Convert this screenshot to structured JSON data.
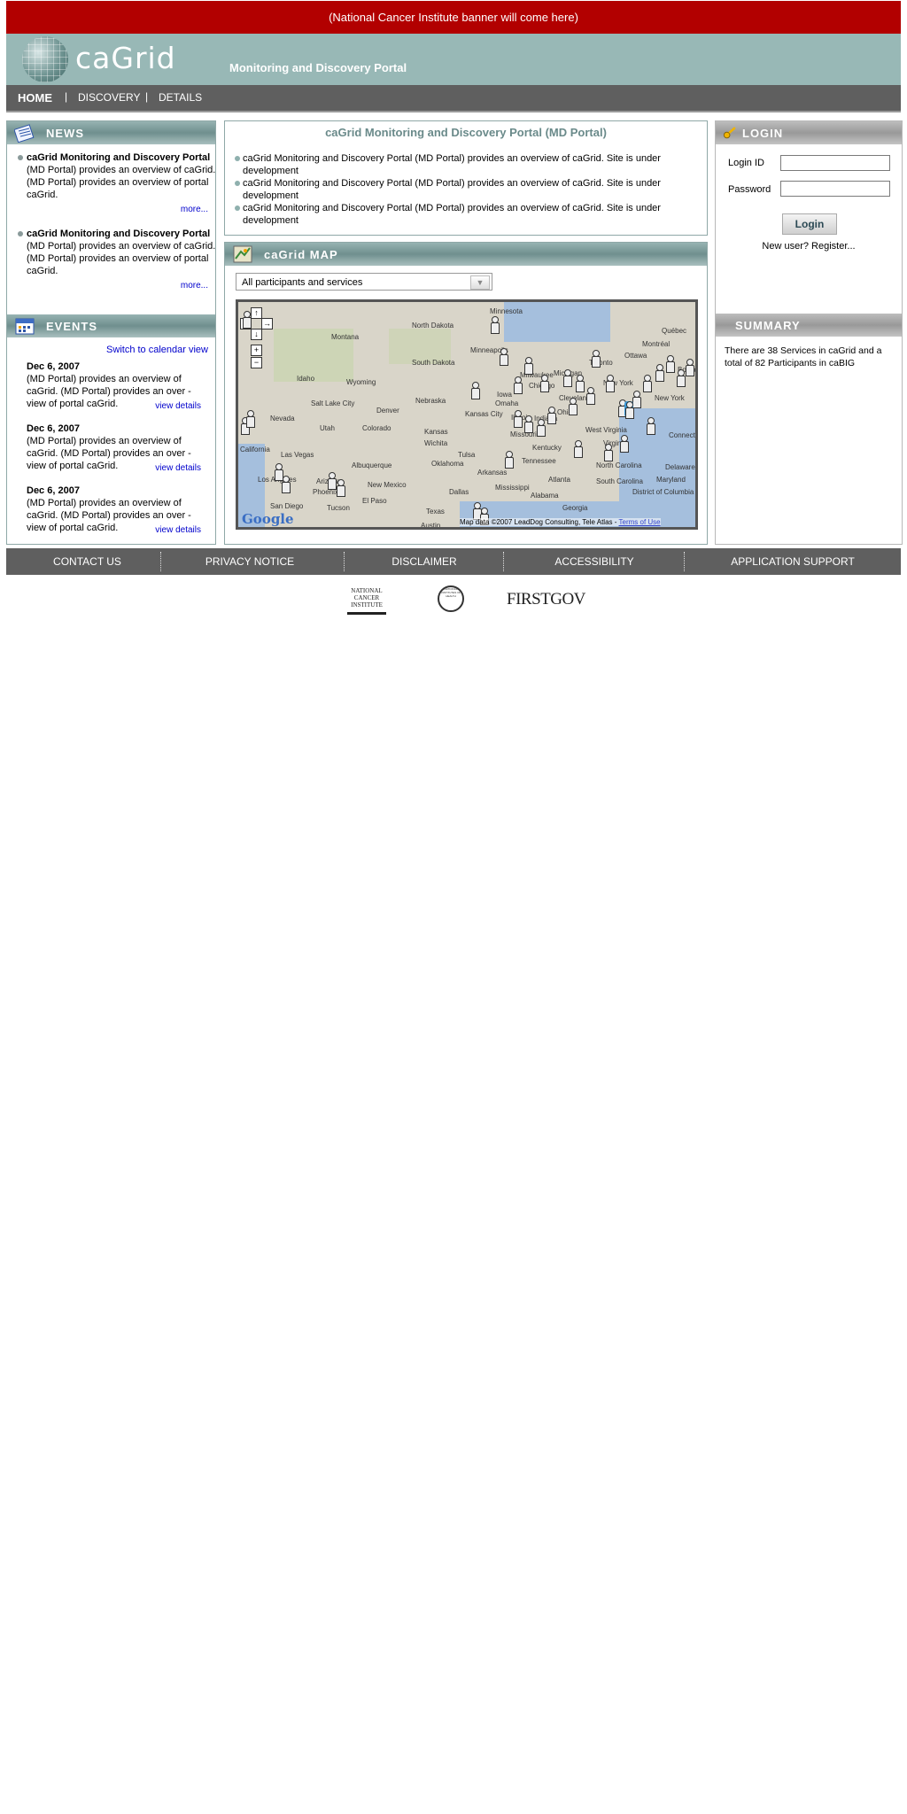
{
  "banner": {
    "text": "(National Cancer Institute banner will come here)"
  },
  "header": {
    "logo_text": "caGrid",
    "portal_title": "Monitoring and Discovery Portal"
  },
  "nav": {
    "items": [
      "HOME",
      "DISCOVERY",
      "DETAILS"
    ],
    "separator": "|"
  },
  "news": {
    "heading": "NEWS",
    "items": [
      {
        "title": "caGrid Monitoring and Discovery Portal",
        "body": "(MD Portal) provides an overview of caGrid. (MD Portal) provides an overview of portal caGrid.",
        "more": "more..."
      },
      {
        "title": "caGrid Monitoring and Discovery Portal",
        "body": "(MD Portal) provides an overview of caGrid. (MD Portal) provides an overview of portal caGrid.",
        "more": "more..."
      }
    ]
  },
  "events": {
    "heading": "EVENTS",
    "calendar_link": "Switch to calendar view",
    "items": [
      {
        "date": "Dec 6, 2007",
        "body": "(MD Portal) provides an overview of caGrid. (MD Portal) provides an over - view of portal caGrid.",
        "link": "view details"
      },
      {
        "date": "Dec 6, 2007",
        "body": "(MD Portal) provides an overview of caGrid. (MD Portal) provides an over - view of portal caGrid.",
        "link": "view details"
      },
      {
        "date": "Dec 6, 2007",
        "body": "(MD Portal) provides an overview of caGrid. (MD Portal) provides an over - view of portal caGrid.",
        "link": "view details"
      }
    ]
  },
  "intro": {
    "title": "caGrid Monitoring and Discovery Portal (MD Portal)",
    "lines": [
      "caGrid Monitoring and Discovery Portal (MD Portal) provides an overview of caGrid.  Site is under development",
      "caGrid Monitoring and Discovery Portal (MD Portal) provides an overview of caGrid.  Site is under development",
      "caGrid Monitoring and Discovery Portal (MD Portal) provides an overview of caGrid.  Site is under development"
    ]
  },
  "map": {
    "heading": "caGrid MAP",
    "select_value": "All participants and services",
    "states": [
      "North Dakota",
      "Minnesota",
      "Montana",
      "South Dakota",
      "Idaho",
      "Wyoming",
      "Nebraska",
      "Iowa",
      "Nevada",
      "Utah",
      "Colorado",
      "Kansas",
      "Missouri",
      "California",
      "Oklahoma",
      "Arkansas",
      "Arizona",
      "New Mexico",
      "Texas",
      "Mississippi",
      "Alabama",
      "Georgia",
      "Tennessee",
      "Kentucky",
      "Illinois",
      "Indiana",
      "Ohio",
      "West Virginia",
      "North Carolina",
      "South Carolina",
      "Virginia",
      "Maryland",
      "Delaware",
      "New York",
      "Michigan",
      "Connecticut",
      "District of Columbia"
    ],
    "cities": [
      "Salt Lake City",
      "Denver",
      "Kansas City",
      "Wichita",
      "Las Vegas",
      "Albuquerque",
      "Phoenix",
      "Tucson",
      "El Paso",
      "Dallas",
      "Austin",
      "Tulsa",
      "Atlanta",
      "Omaha",
      "Minneapolis",
      "Milwaukee",
      "Chicago",
      "Cleveland",
      "Toronto",
      "Ottawa",
      "Montréal",
      "Québec",
      "Boston",
      "New York",
      "San Diego",
      "Los Angeles"
    ],
    "attribution": "Map data ©2007 LeadDog Consulting, Tele Atlas - ",
    "terms": "Terms of Use",
    "powered": "Google"
  },
  "login": {
    "heading": "LOGIN",
    "login_id_label": "Login ID",
    "password_label": "Password",
    "button": "Login",
    "register": "New user? Register..."
  },
  "summary": {
    "heading": "SUMMARY",
    "text": "There are 38 Services in caGrid and a total of 82 Participants in caBIG"
  },
  "footer": {
    "items": [
      "CONTACT US",
      "PRIVACY NOTICE",
      "DISCLAIMER",
      "ACCESSIBILITY",
      "APPLICATION SUPPORT"
    ]
  },
  "footer_logos": [
    "NATIONAL CANCER INSTITUTE",
    "NATIONAL INSTITUTES OF HEALTH",
    "FIRSTGOV"
  ]
}
